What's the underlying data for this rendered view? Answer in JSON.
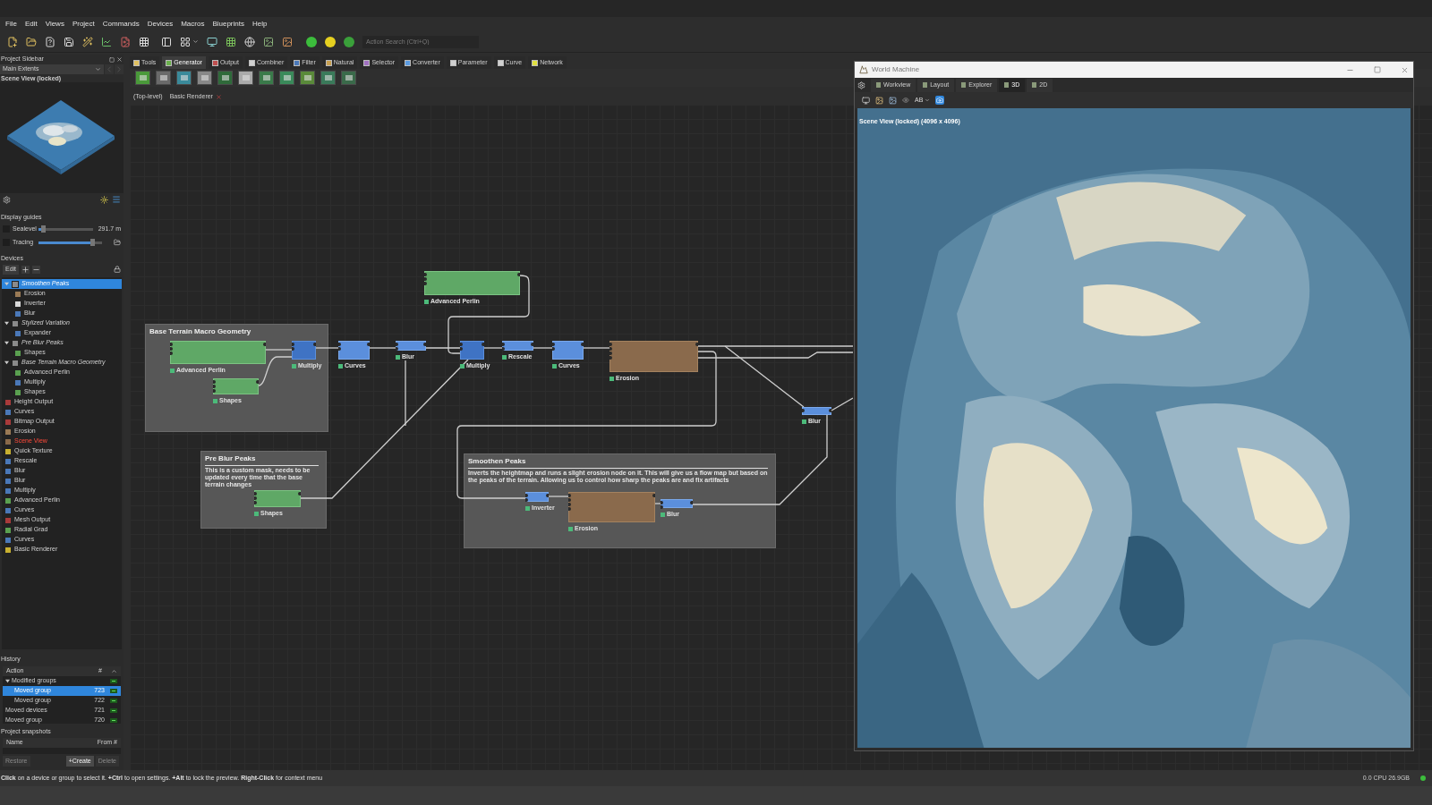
{
  "menu": [
    "File",
    "Edit",
    "Views",
    "Project",
    "Commands",
    "Devices",
    "Macros",
    "Blueprints",
    "Help"
  ],
  "action_search": {
    "placeholder": "Action Search (Ctrl+Q)"
  },
  "sidebar": {
    "title": "Project Sidebar",
    "extents": "Main Extents",
    "scene_label": "Scene View (locked)",
    "display_guides": {
      "title": "Display guides",
      "guides": [
        {
          "label": "Sealevel",
          "checked": false,
          "level": 0.08,
          "reading": "291.7 m"
        },
        {
          "label": "Tracing",
          "checked": false,
          "level": 0.85
        }
      ]
    },
    "devices": {
      "title": "Devices",
      "edit": "Edit",
      "tree": [
        {
          "label": "Smoothen Peaks",
          "kind": "group",
          "expanded": true,
          "selected": true,
          "active": false,
          "children": [
            {
              "label": "Erosion",
              "kind": "natural",
              "selected": false,
              "active": false
            },
            {
              "label": "Inverter",
              "kind": "invert",
              "selected": false,
              "active": false
            },
            {
              "label": "Blur",
              "kind": "filter",
              "selected": false,
              "active": false
            }
          ]
        },
        {
          "label": "Stylized Variation",
          "kind": "group",
          "expanded": true,
          "selected": false,
          "active": false,
          "children": [
            {
              "label": "Expander",
              "kind": "filter",
              "selected": false,
              "active": false
            }
          ]
        },
        {
          "label": "Pre Blur Peaks",
          "kind": "group",
          "expanded": true,
          "selected": false,
          "active": false,
          "children": [
            {
              "label": "Shapes",
              "kind": "generator",
              "selected": false,
              "active": false
            }
          ]
        },
        {
          "label": "Base Terrain Macro Geometry",
          "kind": "group",
          "expanded": true,
          "selected": false,
          "active": false,
          "children": [
            {
              "label": "Advanced Perlin",
              "kind": "generator",
              "selected": false,
              "active": false
            },
            {
              "label": "Multiply",
              "kind": "filter",
              "selected": false,
              "active": false
            },
            {
              "label": "Shapes",
              "kind": "generator",
              "selected": false,
              "active": false
            }
          ]
        },
        {
          "label": "Height Output",
          "kind": "output",
          "selected": false,
          "active": false
        },
        {
          "label": "Curves",
          "kind": "filter",
          "selected": false,
          "active": false
        },
        {
          "label": "Bitmap Output",
          "kind": "output",
          "selected": false,
          "active": false
        },
        {
          "label": "Erosion",
          "kind": "natural",
          "selected": false,
          "active": false
        },
        {
          "label": "Scene View",
          "kind": "view",
          "selected": false,
          "active": true
        },
        {
          "label": "Quick Texture",
          "kind": "texture",
          "selected": false,
          "active": false
        },
        {
          "label": "Rescale",
          "kind": "filter",
          "selected": false,
          "active": false
        },
        {
          "label": "Blur",
          "kind": "filter",
          "selected": false,
          "active": false
        },
        {
          "label": "Blur",
          "kind": "filter",
          "selected": false,
          "active": false
        },
        {
          "label": "Multiply",
          "kind": "filter",
          "selected": false,
          "active": false
        },
        {
          "label": "Advanced Perlin",
          "kind": "generator",
          "selected": false,
          "active": false
        },
        {
          "label": "Curves",
          "kind": "filter",
          "selected": false,
          "active": false
        },
        {
          "label": "Mesh Output",
          "kind": "output",
          "selected": false,
          "active": false
        },
        {
          "label": "Radial Grad",
          "kind": "generator",
          "selected": false,
          "active": false
        },
        {
          "label": "Curves",
          "kind": "filter",
          "selected": false,
          "active": false
        },
        {
          "label": "Basic Renderer",
          "kind": "texture",
          "selected": false,
          "active": false
        }
      ]
    },
    "history": {
      "title": "History",
      "columns": [
        "Action",
        "#"
      ],
      "rows": [
        {
          "label": "Modified groups",
          "expanded": true,
          "selected": false,
          "children": [
            {
              "label": "Moved group",
              "number": "723",
              "selected": true
            },
            {
              "label": "Moved group",
              "number": "722",
              "selected": false
            }
          ]
        },
        {
          "label": "Moved devices",
          "number": "721",
          "selected": false
        },
        {
          "label": "Moved group",
          "number": "720",
          "selected": false
        }
      ]
    },
    "snapshots": {
      "title": "Project snapshots",
      "columns": [
        "Name",
        "From #"
      ],
      "buttons": [
        {
          "label": "Restore",
          "disabled": true
        },
        {
          "label": "+Create",
          "disabled": false
        },
        {
          "label": "Delete",
          "disabled": true
        }
      ]
    }
  },
  "graph": {
    "tabs": [
      {
        "label": "Tools",
        "selected": false
      },
      {
        "label": "Generator",
        "selected": true
      },
      {
        "label": "Output",
        "selected": false
      },
      {
        "label": "Combiner",
        "selected": false
      },
      {
        "label": "Filter",
        "selected": false
      },
      {
        "label": "Natural",
        "selected": false
      },
      {
        "label": "Selector",
        "selected": false
      },
      {
        "label": "Converter",
        "selected": false
      },
      {
        "label": "Parameter",
        "selected": false
      },
      {
        "label": "Curve",
        "selected": false
      },
      {
        "label": "Network",
        "selected": false
      }
    ],
    "breadcrumbs": [
      {
        "label": "(Top-level)",
        "closable": false
      },
      {
        "label": "Basic Renderer",
        "closable": true
      }
    ],
    "groups": [
      {
        "title": "Base Terrain Macro Geometry"
      },
      {
        "title": "Pre Blur Peaks",
        "description": "This is a custom mask, needs to be updated every time that the base terrain changes"
      },
      {
        "title": "Smoothen Peaks",
        "description": "Inverts the heightmap and runs a slight erosion node on it. This will give us a flow map but based on the peaks of the terrain. Allowing us to control how sharp the peaks are and fix artifacts"
      }
    ],
    "nodes": [
      {
        "label": "Advanced Perlin",
        "kind": "generator"
      },
      {
        "label": "Advanced Perlin",
        "kind": "generator"
      },
      {
        "label": "Multiply",
        "kind": "combiner"
      },
      {
        "label": "Shapes",
        "kind": "generator"
      },
      {
        "label": "Curves",
        "kind": "filter"
      },
      {
        "label": "Blur",
        "kind": "filter"
      },
      {
        "label": "Multiply",
        "kind": "combiner"
      },
      {
        "label": "Rescale",
        "kind": "filter"
      },
      {
        "label": "Curves",
        "kind": "filter"
      },
      {
        "label": "Erosion",
        "kind": "natural"
      },
      {
        "label": "Shapes",
        "kind": "generator"
      },
      {
        "label": "Inverter",
        "kind": "filter"
      },
      {
        "label": "Erosion",
        "kind": "natural"
      },
      {
        "label": "Blur",
        "kind": "filter"
      },
      {
        "label": "Blur",
        "kind": "filter"
      }
    ]
  },
  "viewer": {
    "title": "World Machine",
    "tabs": [
      {
        "label": "Workview",
        "selected": false
      },
      {
        "label": "Layout",
        "selected": false
      },
      {
        "label": "Explorer",
        "selected": false
      },
      {
        "label": "3D",
        "selected": true
      },
      {
        "label": "2D",
        "selected": false
      }
    ],
    "ab": "AB",
    "scene_label": "Scene View (locked) (4096 x 4096)"
  },
  "status": {
    "hint": "**Click** on a device or group to select it. **+Ctrl** to open settings. **+Alt** to lock the preview. **Right-Click** for context menu",
    "stats": "0.0 CPU 26.9GB"
  }
}
